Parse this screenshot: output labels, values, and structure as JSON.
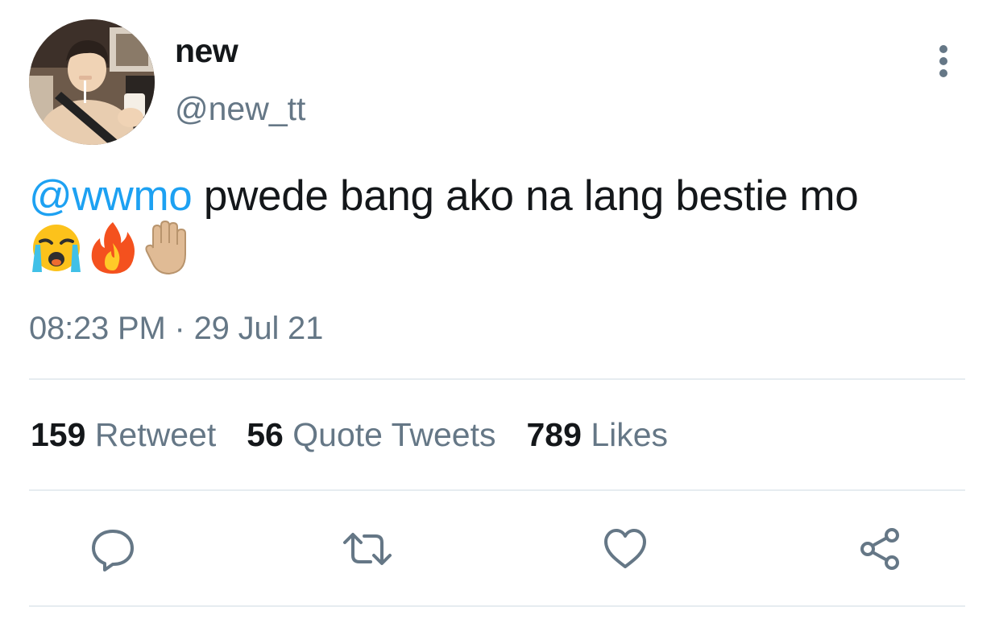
{
  "tweet": {
    "display_name": "new",
    "handle": "@new_tt",
    "mention": "@wwmo",
    "text": " pwede bang ako na lang bestie mo",
    "emojis": [
      "loudly-crying-face",
      "fire",
      "raised-hand"
    ],
    "time": "08:23 PM",
    "separator": "·",
    "date": "29 Jul 21"
  },
  "stats": {
    "retweets": {
      "count": "159",
      "label": "Retweet"
    },
    "quotes": {
      "count": "56",
      "label": "Quote Tweets"
    },
    "likes": {
      "count": "789",
      "label": "Likes"
    }
  },
  "actions": {
    "icons": [
      "reply-icon",
      "retweet-icon",
      "like-icon",
      "share-icon"
    ]
  },
  "colors": {
    "mention": "#1da1f2",
    "secondary_text": "#657786",
    "primary_text": "#14171a",
    "divider": "#e6ecf0"
  }
}
